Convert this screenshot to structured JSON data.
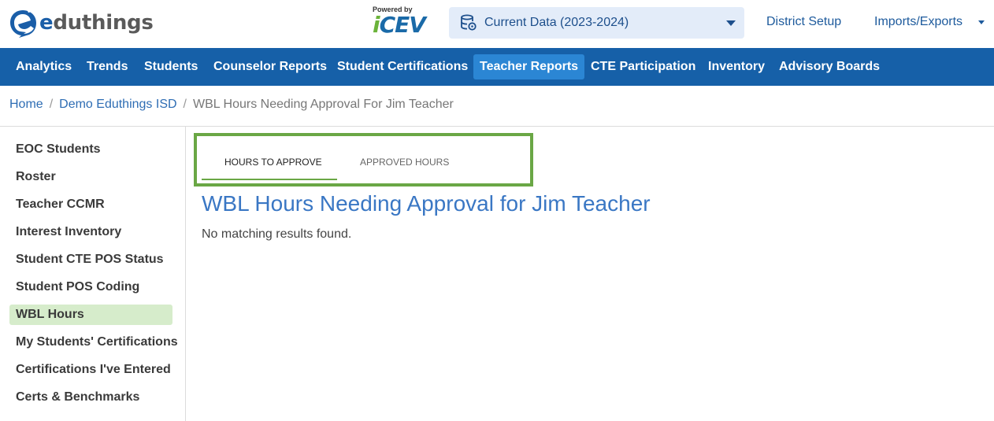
{
  "header": {
    "logo_text": "eduthings",
    "powered_by": "Powered by",
    "icev_logo": "iCEV",
    "data_select": "Current Data (2023-2024)",
    "links": {
      "district_setup": "District Setup",
      "imports_exports": "Imports/Exports"
    }
  },
  "nav": {
    "items": [
      {
        "label": "Analytics",
        "active": false
      },
      {
        "label": "Trends",
        "active": false
      },
      {
        "label": "Students",
        "active": false
      },
      {
        "label": "Counselor Reports",
        "active": false
      },
      {
        "label": "Student Certifications",
        "active": false
      },
      {
        "label": "Teacher Reports",
        "active": true
      },
      {
        "label": "CTE Participation",
        "active": false
      },
      {
        "label": "Inventory",
        "active": false
      },
      {
        "label": "Advisory Boards",
        "active": false
      }
    ]
  },
  "breadcrumb": {
    "home": "Home",
    "district": "Demo Eduthings ISD",
    "current": "WBL Hours Needing Approval For Jim Teacher",
    "separator": "/"
  },
  "sidebar": {
    "items": [
      {
        "label": "EOC Students",
        "active": false
      },
      {
        "label": "Roster",
        "active": false
      },
      {
        "label": "Teacher CCMR",
        "active": false
      },
      {
        "label": "Interest Inventory",
        "active": false
      },
      {
        "label": "Student CTE POS Status",
        "active": false
      },
      {
        "label": "Student POS Coding",
        "active": false
      },
      {
        "label": "WBL Hours",
        "active": true
      },
      {
        "label": "My Students' Certifications",
        "active": false
      },
      {
        "label": "Certifications I've Entered",
        "active": false
      },
      {
        "label": "Certs & Benchmarks",
        "active": false
      }
    ]
  },
  "tabs": {
    "hours_to_approve": "HOURS TO APPROVE",
    "approved_hours": "APPROVED HOURS",
    "active_tab": "HOURS TO APPROVE"
  },
  "main": {
    "title": "WBL Hours Needing Approval for Jim Teacher",
    "empty_message": "No matching results found."
  },
  "colors": {
    "nav_bg": "#1660a8",
    "nav_active": "#2b86d4",
    "highlight_box": "#6aa745",
    "sidebar_active": "#d6eccb",
    "title": "#3a77c4"
  }
}
